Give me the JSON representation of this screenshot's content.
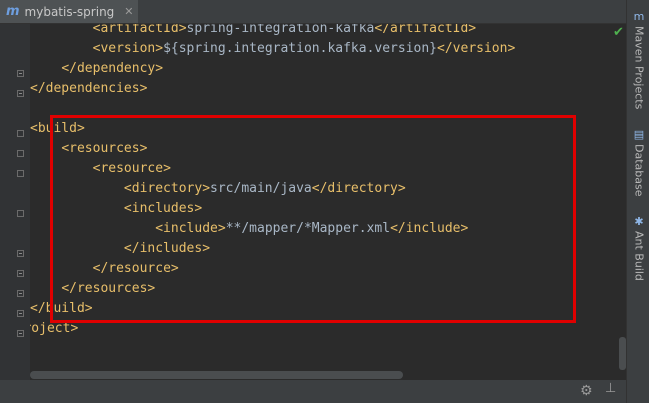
{
  "tab": {
    "icon": "m",
    "title": "mybatis-spring",
    "close": "✕"
  },
  "status": {
    "ok_mark": "✔"
  },
  "code": {
    "lines": [
      {
        "indent": "        ",
        "open": "<artifactId>",
        "text": "spring-integration-kafka",
        "close": "</artifactId>"
      },
      {
        "indent": "        ",
        "open": "<version>",
        "text": "${spring.integration.kafka.version}",
        "close": "</version>"
      },
      {
        "indent": "    ",
        "open": "</dependency>",
        "text": "",
        "close": ""
      },
      {
        "indent": "",
        "open": "</dependencies>",
        "text": "",
        "close": ""
      },
      {
        "indent": "",
        "open": "",
        "text": "",
        "close": ""
      },
      {
        "indent": "",
        "open": "<build>",
        "text": "",
        "close": ""
      },
      {
        "indent": "    ",
        "open": "<resources>",
        "text": "",
        "close": ""
      },
      {
        "indent": "        ",
        "open": "<resource>",
        "text": "",
        "close": ""
      },
      {
        "indent": "            ",
        "open": "<directory>",
        "text": "src/main/java",
        "close": "</directory>"
      },
      {
        "indent": "            ",
        "open": "<includes>",
        "text": "",
        "close": ""
      },
      {
        "indent": "                ",
        "open": "<include>",
        "text": "**/mapper/*Mapper.xml",
        "close": "</include>"
      },
      {
        "indent": "            ",
        "open": "</includes>",
        "text": "",
        "close": ""
      },
      {
        "indent": "        ",
        "open": "</resource>",
        "text": "",
        "close": ""
      },
      {
        "indent": "    ",
        "open": "</resources>",
        "text": "",
        "close": ""
      },
      {
        "indent": "",
        "open": "</build>",
        "text": "",
        "close": ""
      },
      {
        "indent": "",
        "open": "</project>",
        "text": "",
        "close": ""
      }
    ]
  },
  "bottom_toolbar": {
    "settings_icon": "gear-icon",
    "gear_glyph": "⚙",
    "hide_icon": "pin-icon",
    "hide_glyph": "⊥"
  },
  "right_toolbar": {
    "items": [
      {
        "label": "Maven Projects",
        "icon": "m"
      },
      {
        "label": "Database",
        "icon": "▤"
      },
      {
        "label": "Ant Build",
        "icon": "✱"
      }
    ]
  },
  "colors": {
    "tag": "#e8bf6a",
    "text": "#a9b7c6",
    "background": "#2b2b2b",
    "highlight": "#e00000"
  }
}
